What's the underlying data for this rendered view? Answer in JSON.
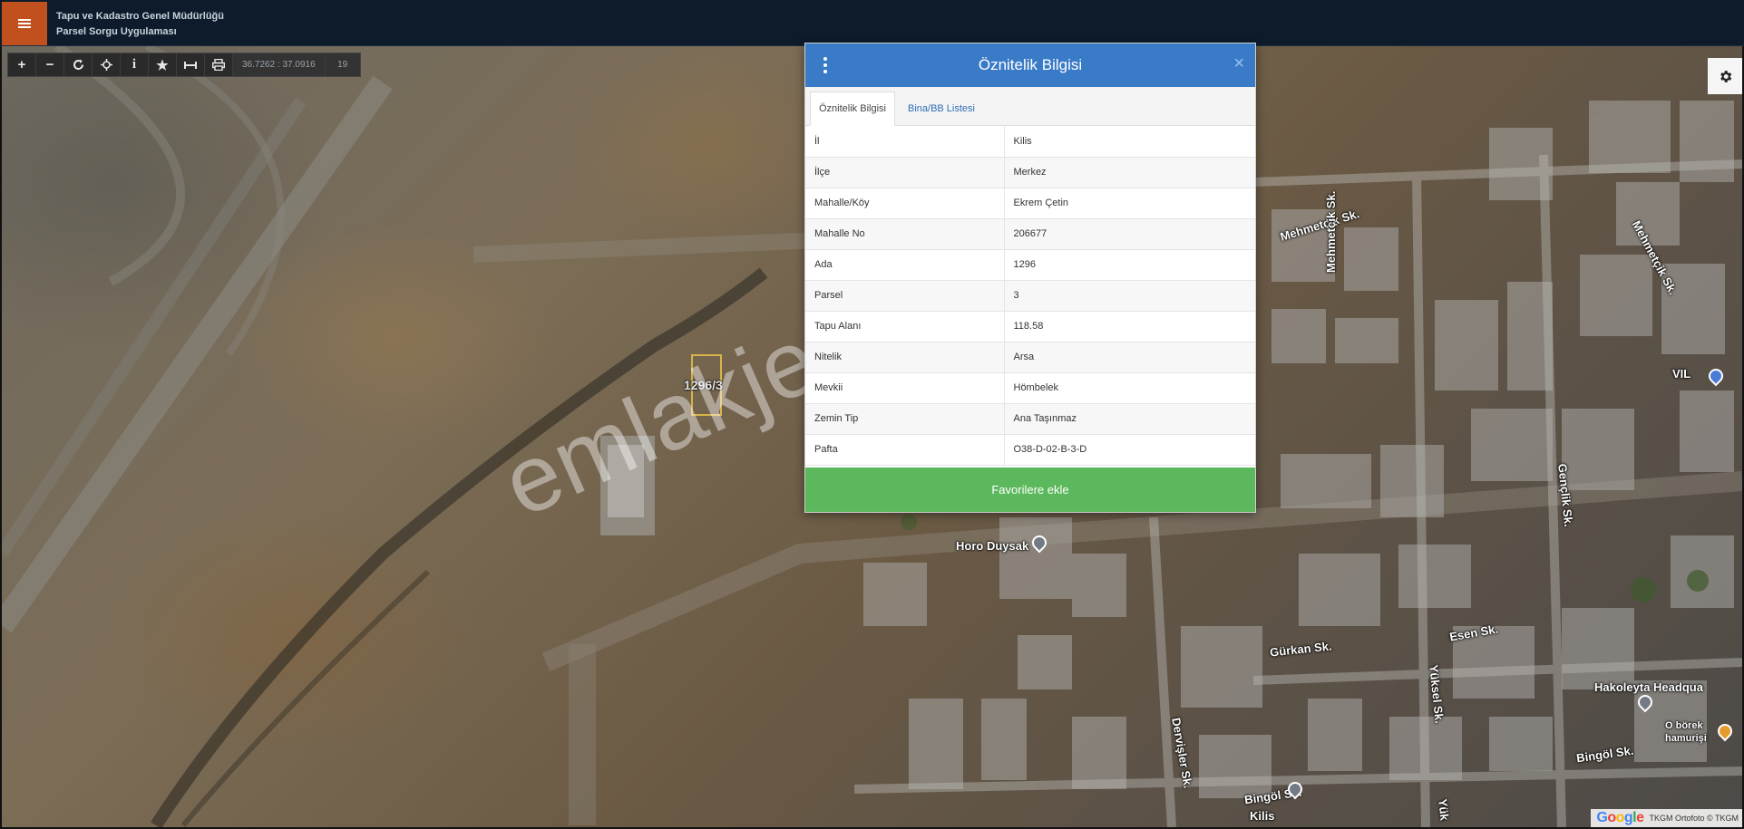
{
  "header": {
    "title_line1": "Tapu ve Kadastro Genel Müdürlüğü",
    "title_line2": "Parsel Sorgu Uygulaması"
  },
  "toolbar": {
    "tools": [
      "zoom-in-icon",
      "zoom-out-icon",
      "refresh-icon",
      "locate-icon",
      "info-icon",
      "star-icon",
      "measure-icon",
      "print-icon"
    ],
    "coordinates": "36.7262 : 37.0916",
    "zoom_level": "19"
  },
  "map": {
    "parcel_label": "1296/3",
    "watermark": "emlakjet.com",
    "streets": {
      "mehmetcik_1": "Mehmetçik Sk.",
      "mehmetcik_2": "Mehmetçik Sk.",
      "mehmetcik_3": "Mehmetçik Sk.",
      "genclik": "Gençlik Sk.",
      "esen": "Esen Sk.",
      "gurkan": "Gürkan Sk.",
      "yuksel": "Yüksel Sk.",
      "dervisler": "Dervişler Sk.",
      "bingol_1": "Bingöl Sk.",
      "bingol_2": "Bingöl Sk.",
      "yuk": "Yük",
      "kilis": "Kilis"
    },
    "pois": {
      "horo": "Horo Duysak",
      "hakoleyta": "Hakoleyta Headqua",
      "oborek_1": "O börek",
      "oborek_2": "hamurişi",
      "vil": "VIL"
    },
    "attribution": "TKGM Ortofoto © TKGM"
  },
  "modal": {
    "title": "Öznitelik Bilgisi",
    "close": "×",
    "tabs": [
      "Öznitelik Bilgisi",
      "Bina/BB Listesi"
    ],
    "rows": [
      {
        "key": "İl",
        "value": "Kilis"
      },
      {
        "key": "İlçe",
        "value": "Merkez"
      },
      {
        "key": "Mahalle/Köy",
        "value": "Ekrem Çetin"
      },
      {
        "key": "Mahalle No",
        "value": "206677"
      },
      {
        "key": "Ada",
        "value": "1296"
      },
      {
        "key": "Parsel",
        "value": "3"
      },
      {
        "key": "Tapu Alanı",
        "value": "118.58"
      },
      {
        "key": "Nitelik",
        "value": "Arsa"
      },
      {
        "key": "Mevkii",
        "value": "Hömbelek"
      },
      {
        "key": "Zemin Tip",
        "value": "Ana Taşınmaz"
      },
      {
        "key": "Pafta",
        "value": "O38-D-02-B-3-D"
      }
    ],
    "favorite_button": "Favorilere ekle"
  },
  "colors": {
    "header_bg": "#0d1b2a",
    "menu_accent": "#c0501d",
    "modal_header": "#3a7bc8",
    "favorite_green": "#5cb85c"
  }
}
